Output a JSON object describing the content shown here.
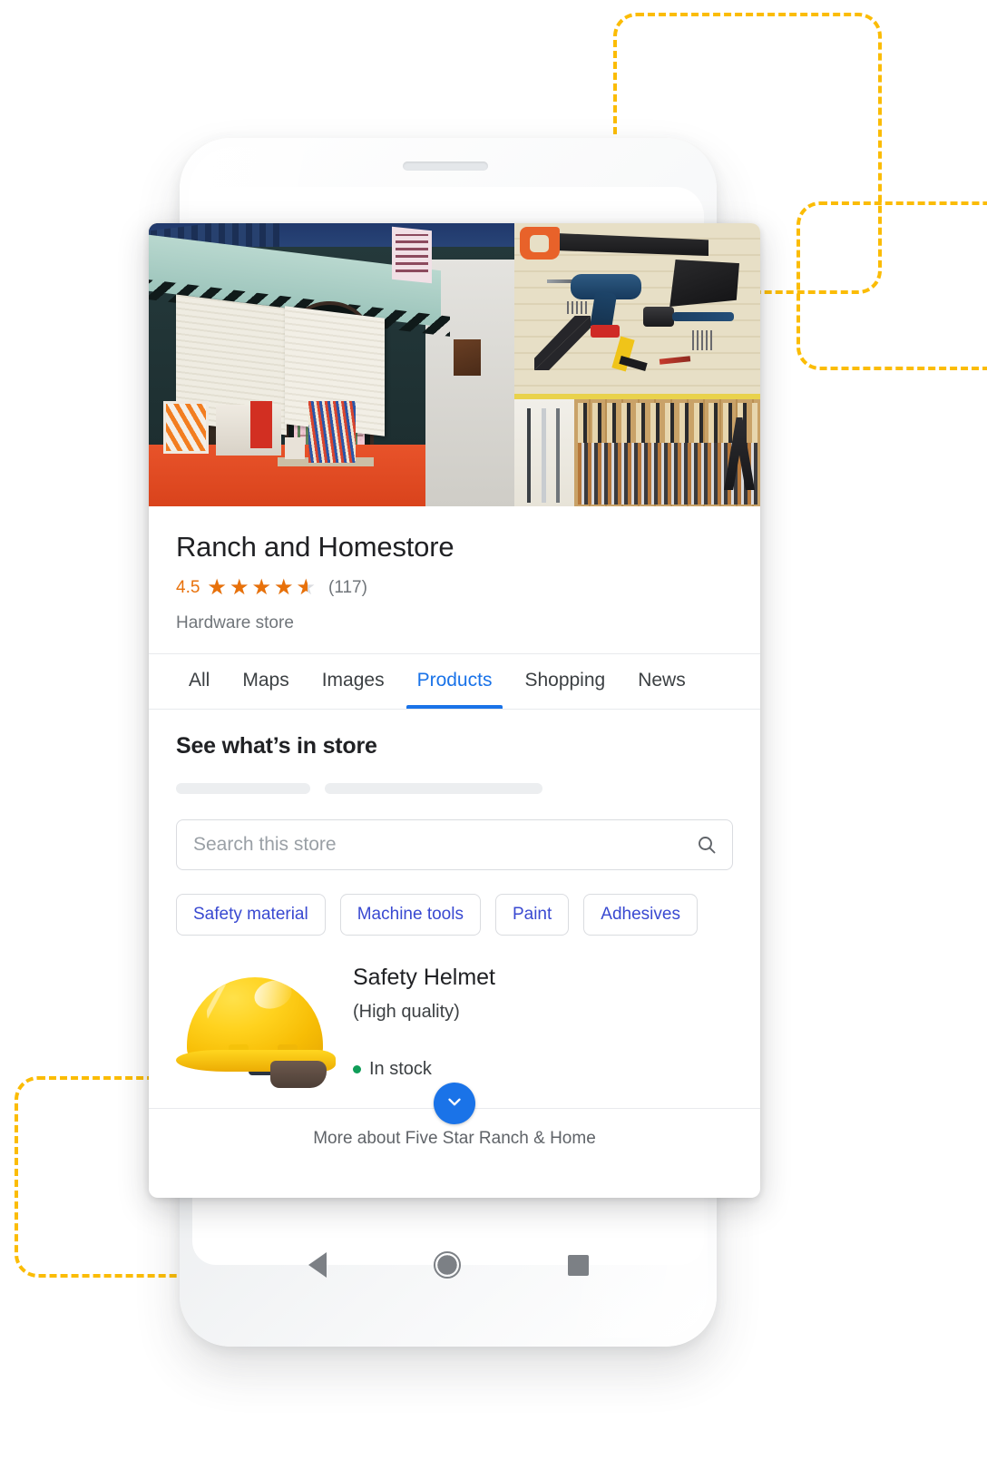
{
  "store": {
    "name": "Ranch and Homestore",
    "rating_value": "4.5",
    "rating_stars": "★★★★★",
    "rating_count": "(117)",
    "category": "Hardware store"
  },
  "tabs": [
    {
      "label": "All",
      "active": false
    },
    {
      "label": "Maps",
      "active": false
    },
    {
      "label": "Images",
      "active": false
    },
    {
      "label": "Products",
      "active": true
    },
    {
      "label": "Shopping",
      "active": false
    },
    {
      "label": "News",
      "active": false
    }
  ],
  "section": {
    "title": "See what’s in store"
  },
  "search": {
    "placeholder": "Search this store",
    "value": "",
    "icon": "search-icon"
  },
  "chips": [
    {
      "label": "Safety material"
    },
    {
      "label": "Machine tools"
    },
    {
      "label": "Paint"
    },
    {
      "label": "Adhesives"
    }
  ],
  "product": {
    "name": "Safety Helmet",
    "subtitle": "(High quality)",
    "stock_status": "In stock"
  },
  "footer": {
    "expand_icon": "chevron-down-icon",
    "more_label": "More about Five Star Ranch & Home"
  },
  "device": {
    "nav_back": "back-icon",
    "nav_home": "home-icon",
    "nav_recent": "recents-icon"
  },
  "colors": {
    "accent_blue": "#1a73e8",
    "star_orange": "#e8710a",
    "chip_text": "#3949d1",
    "stock_green": "#0f9d58",
    "dashed_yellow": "#fbbc05"
  }
}
